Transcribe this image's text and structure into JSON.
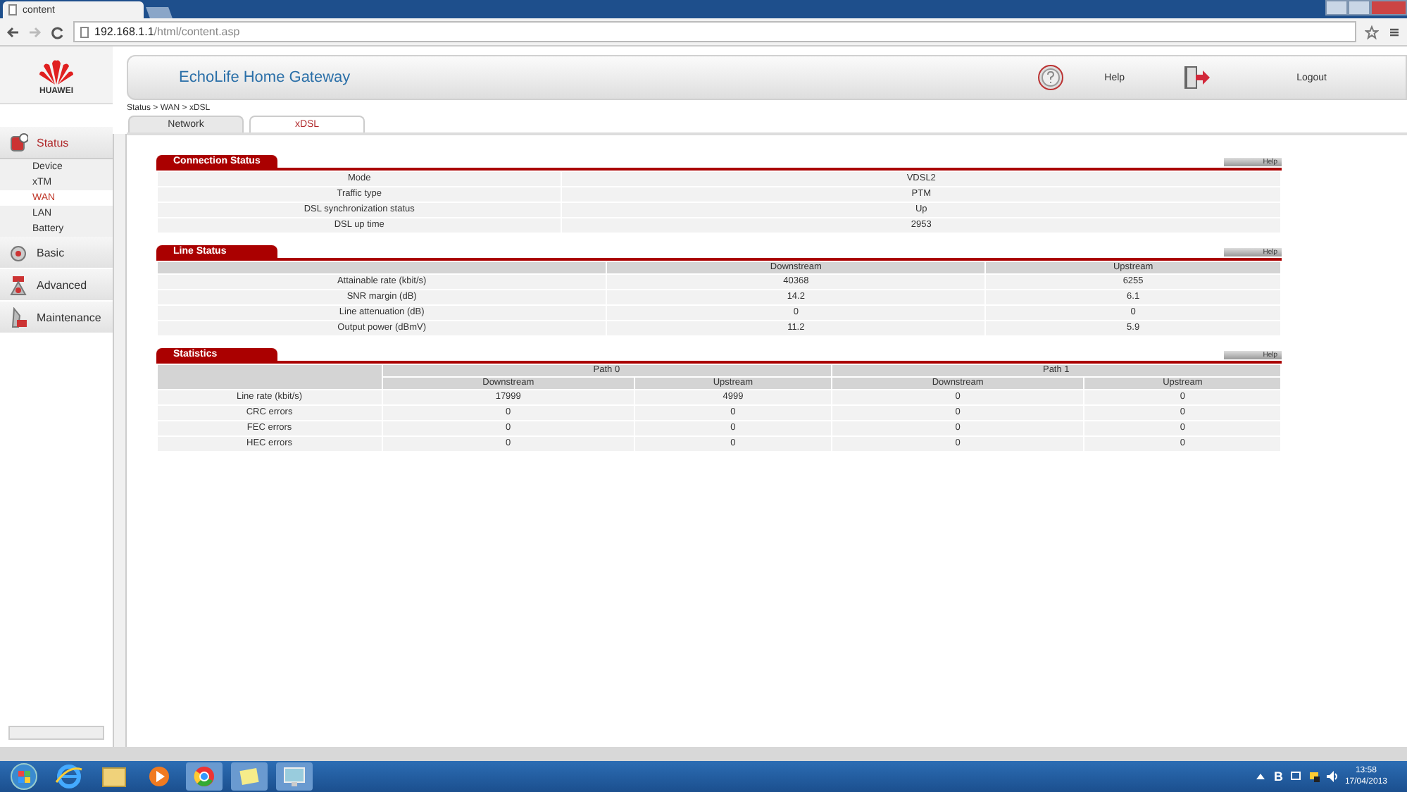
{
  "browser": {
    "tab_title": "content",
    "url_host": "192.168.1.1",
    "url_path": "/html/content.asp"
  },
  "brand": "HUAWEI",
  "header": {
    "title": "EchoLife Home Gateway",
    "help": "Help",
    "logout": "Logout"
  },
  "sidebar": {
    "items": [
      {
        "label": "Status",
        "selected": true,
        "expanded": true,
        "children": [
          {
            "label": "Device",
            "selected": false
          },
          {
            "label": "xTM",
            "selected": false
          },
          {
            "label": "WAN",
            "selected": true
          },
          {
            "label": "LAN",
            "selected": false
          },
          {
            "label": "Battery",
            "selected": false
          }
        ]
      },
      {
        "label": "Basic",
        "selected": false,
        "expanded": false
      },
      {
        "label": "Advanced",
        "selected": false,
        "expanded": false
      },
      {
        "label": "Maintenance",
        "selected": false,
        "expanded": false
      }
    ]
  },
  "breadcrumb": "Status > WAN > xDSL",
  "tabs": [
    {
      "label": "Network",
      "selected": false
    },
    {
      "label": "xDSL",
      "selected": true
    }
  ],
  "sections": [
    {
      "kind": "keyvalue",
      "title": "Connection Status",
      "help": "Help",
      "rows": [
        {
          "label": "Mode",
          "value": "VDSL2"
        },
        {
          "label": "Traffic type",
          "value": "PTM"
        },
        {
          "label": "DSL synchronization status",
          "value": "Up"
        },
        {
          "label": "DSL up time",
          "value": "2953"
        }
      ]
    },
    {
      "kind": "grid",
      "title": "Line Status",
      "help": "Help",
      "columns": [
        "Downstream",
        "Upstream"
      ],
      "rows": [
        {
          "label": "Attainable rate (kbit/s)",
          "values": [
            "40368",
            "6255"
          ]
        },
        {
          "label": "SNR margin (dB)",
          "values": [
            "14.2",
            "6.1"
          ]
        },
        {
          "label": "Line attenuation (dB)",
          "values": [
            "0",
            "0"
          ]
        },
        {
          "label": "Output power (dBmV)",
          "values": [
            "11.2",
            "5.9"
          ]
        }
      ]
    },
    {
      "kind": "paths",
      "title": "Statistics",
      "help": "Help",
      "groups": [
        "Path 0",
        "Path 1"
      ],
      "columns": [
        "Downstream",
        "Upstream",
        "Downstream",
        "Upstream"
      ],
      "rows": [
        {
          "label": "Line rate (kbit/s)",
          "values": [
            "17999",
            "4999",
            "0",
            "0"
          ]
        },
        {
          "label": "CRC errors",
          "values": [
            "0",
            "0",
            "0",
            "0"
          ]
        },
        {
          "label": "FEC errors",
          "values": [
            "0",
            "0",
            "0",
            "0"
          ]
        },
        {
          "label": "HEC errors",
          "values": [
            "0",
            "0",
            "0",
            "0"
          ]
        }
      ]
    }
  ],
  "taskbar": {
    "tray_letter": "B",
    "time": "13:58",
    "date": "17/04/2013"
  }
}
